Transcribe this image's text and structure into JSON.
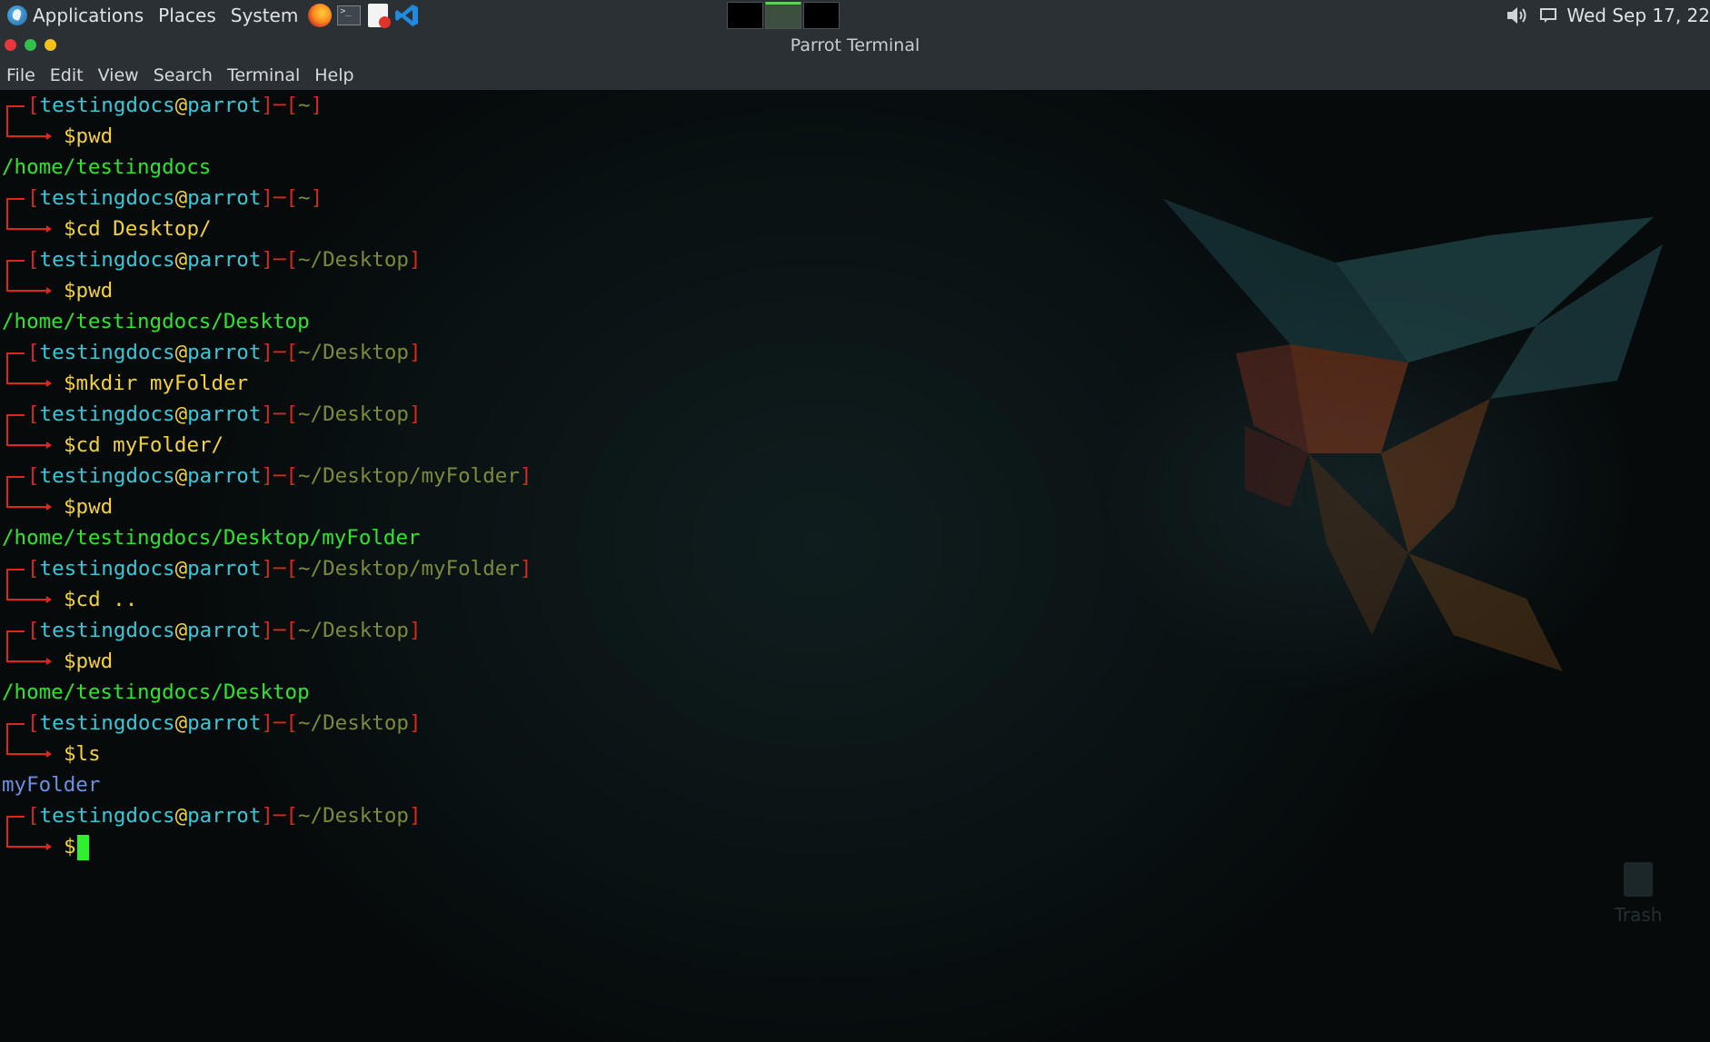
{
  "top_panel": {
    "menus": [
      "Applications",
      "Places",
      "System"
    ],
    "launchers": [
      {
        "icon": "firefox-icon"
      },
      {
        "icon": "terminal-icon"
      },
      {
        "icon": "text-editor-icon"
      },
      {
        "icon": "vscode-icon"
      }
    ],
    "workspaces": [
      {
        "active": false
      },
      {
        "active": true
      },
      {
        "active": false
      }
    ],
    "clock": "Wed Sep 17, 22"
  },
  "window": {
    "title": "Parrot Terminal",
    "menu": [
      "File",
      "Edit",
      "View",
      "Search",
      "Terminal",
      "Help"
    ]
  },
  "terminal": {
    "user": "testingdocs",
    "host": "parrot",
    "session": [
      {
        "cwd": "~",
        "cmd": "pwd",
        "output": [
          "/home/testingdocs"
        ]
      },
      {
        "cwd": "~",
        "cmd": "cd Desktop/",
        "output": []
      },
      {
        "cwd": "~/Desktop",
        "cmd": "pwd",
        "output": [
          "/home/testingdocs/Desktop"
        ]
      },
      {
        "cwd": "~/Desktop",
        "cmd": "mkdir myFolder",
        "output": []
      },
      {
        "cwd": "~/Desktop",
        "cmd": "cd myFolder/",
        "output": []
      },
      {
        "cwd": "~/Desktop/myFolder",
        "cmd": "pwd",
        "output": [
          "/home/testingdocs/Desktop/myFolder"
        ]
      },
      {
        "cwd": "~/Desktop/myFolder",
        "cmd": "cd ..",
        "output": []
      },
      {
        "cwd": "~/Desktop",
        "cmd": "pwd",
        "output": [
          "/home/testingdocs/Desktop"
        ]
      },
      {
        "cwd": "~/Desktop",
        "cmd": "ls",
        "output": [
          "myFolder"
        ],
        "output_style": "blue"
      },
      {
        "cwd": "~/Desktop",
        "cmd": "",
        "output": [],
        "cursor": true
      }
    ]
  },
  "desktop": {
    "trash_label": "Trash"
  },
  "colors": {
    "bracket": "#d22a1f",
    "user": "#38c8d9",
    "at": "#f2d13a",
    "path": "#7c8a3a",
    "command": "#f2d13a",
    "output": "#2ee52e",
    "directory": "#6d8fe0",
    "cursor": "#2ef02e"
  }
}
